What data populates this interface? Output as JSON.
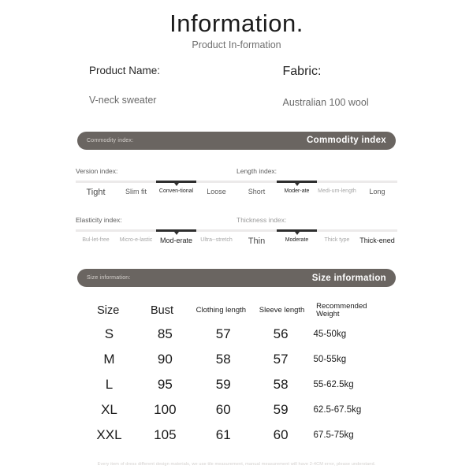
{
  "header": {
    "title": "Information.",
    "subtitle": "Product In-formation"
  },
  "specs": {
    "product_name_label": "Product Name:",
    "product_name_value": "V-neck sweater",
    "fabric_label": "Fabric:",
    "fabric_value": "Australian 100 wool"
  },
  "banners": {
    "commodity_left": "Commodity index:",
    "commodity_right": "Commodity index",
    "size_left": "Size information:",
    "size_right": "Size information"
  },
  "indexes": [
    {
      "title": "Version index:",
      "selected": 2,
      "options": [
        "Tight",
        "Slim fit",
        "Conven-tional",
        "Loose"
      ]
    },
    {
      "title": "Length index:",
      "selected": 1,
      "options": [
        "Short",
        "Moder-ate",
        "Medi-um-length",
        "Long"
      ]
    },
    {
      "title": "Elasticity index:",
      "selected": 2,
      "options": [
        "Bul-let-free",
        "Micro-e-lastic",
        "Mod-erate",
        "Ultra--stretch"
      ]
    },
    {
      "title": "Thickness index:",
      "selected": 1,
      "options": [
        "Thin",
        "Moderate",
        "Thick type",
        "Thick-ened"
      ]
    }
  ],
  "size_table": {
    "columns": [
      "Size",
      "Bust",
      "Clothing length",
      "Sleeve length",
      "Recommended Weight"
    ],
    "rows": [
      [
        "S",
        "85",
        "57",
        "56",
        "45-50kg"
      ],
      [
        "M",
        "90",
        "58",
        "57",
        "50-55kg"
      ],
      [
        "L",
        "95",
        "59",
        "58",
        "55-62.5kg"
      ],
      [
        "XL",
        "100",
        "60",
        "59",
        "62.5-67.5kg"
      ],
      [
        "XXL",
        "105",
        "61",
        "60",
        "67.5-75kg"
      ]
    ]
  },
  "footer": {
    "disclaimer": "Every item of dress different design materials, we use tile measurement, manual measurement will have 2-4CM error, please understand."
  },
  "colors": {
    "banner": "#6a6561",
    "track": "#eceaea",
    "track_active": "#2e2e2e"
  }
}
